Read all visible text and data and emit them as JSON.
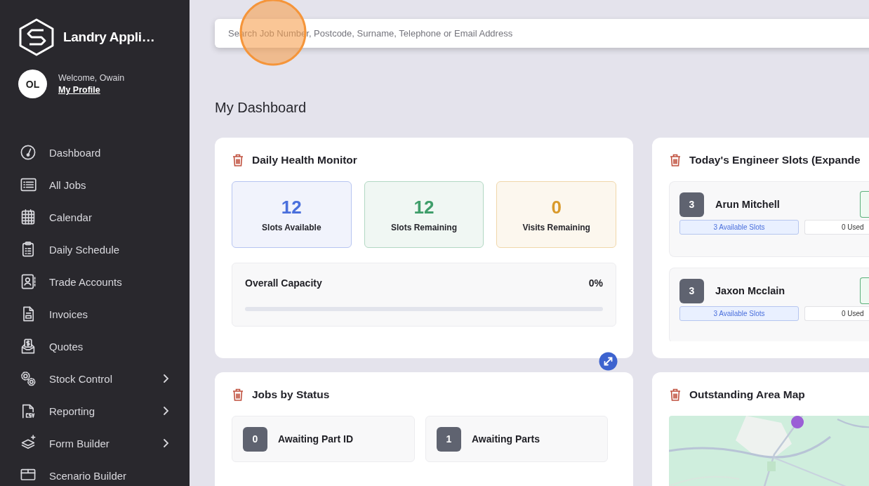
{
  "sidebar": {
    "brand": "Landry Appli…",
    "user": {
      "initials": "OL",
      "welcome": "Welcome, Owain",
      "profile_link": "My Profile"
    },
    "items": [
      {
        "label": "Dashboard",
        "has_submenu": false
      },
      {
        "label": "All Jobs",
        "has_submenu": false
      },
      {
        "label": "Calendar",
        "has_submenu": false
      },
      {
        "label": "Daily Schedule",
        "has_submenu": false
      },
      {
        "label": "Trade Accounts",
        "has_submenu": false
      },
      {
        "label": "Invoices",
        "has_submenu": false
      },
      {
        "label": "Quotes",
        "has_submenu": false
      },
      {
        "label": "Stock Control",
        "has_submenu": true
      },
      {
        "label": "Reporting",
        "has_submenu": true
      },
      {
        "label": "Form Builder",
        "has_submenu": true
      },
      {
        "label": "Scenario Builder",
        "has_submenu": false
      }
    ]
  },
  "search": {
    "placeholder": "Search Job Number, Postcode, Surname, Telephone or Email Address"
  },
  "page_title": "My Dashboard",
  "health_monitor": {
    "title": "Daily Health Monitor",
    "stats": [
      {
        "value": "12",
        "label": "Slots Available",
        "color": "#4a6fdc"
      },
      {
        "value": "12",
        "label": "Slots Remaining",
        "color": "#3f9e6a"
      },
      {
        "value": "0",
        "label": "Visits Remaining",
        "color": "#d99a2b"
      }
    ],
    "capacity": {
      "label": "Overall Capacity",
      "reading": "0%",
      "level": 0
    }
  },
  "engineer_slots": {
    "title": "Today's Engineer Slots (Expande",
    "engineers": [
      {
        "count": "3",
        "name": "Arun Mitchell",
        "available": "3 Available Slots",
        "used": "0 Used"
      },
      {
        "count": "3",
        "name": "Jaxon Mcclain",
        "available": "3 Available Slots",
        "used": "0 Used"
      }
    ]
  },
  "jobs_by_status": {
    "title": "Jobs by Status",
    "statuses": [
      {
        "count": "0",
        "label": "Awaiting Part ID"
      },
      {
        "count": "1",
        "label": "Awaiting Parts"
      }
    ]
  },
  "area_map": {
    "title": "Outstanding Area Map"
  }
}
